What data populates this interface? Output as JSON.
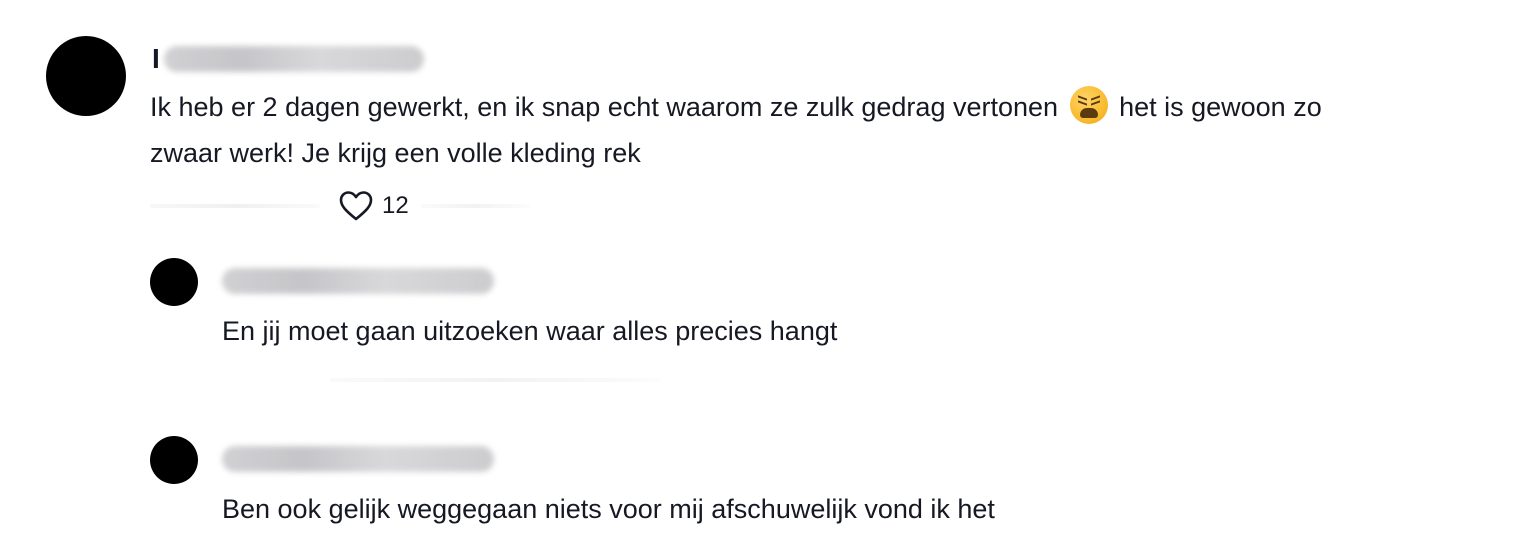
{
  "comment": {
    "username_initial": "I",
    "text_before_emoji": "Ik heb er 2 dagen gewerkt, en ik snap echt waarom ze zulk gedrag vertonen",
    "emoji": "tired-face-emoji",
    "text_after_emoji": "het is gewoon zo",
    "text_line2": "zwaar werk! Je krijg een volle kleding rek",
    "likes": "12"
  },
  "replies": [
    {
      "text": "En jij moet gaan uitzoeken waar alles precies hangt"
    },
    {
      "text": "Ben ook gelijk weggegaan niets voor mij afschuwelijk vond ik het"
    }
  ],
  "colors": {
    "text": "#161823",
    "avatar": "#000000",
    "background": "#ffffff"
  }
}
